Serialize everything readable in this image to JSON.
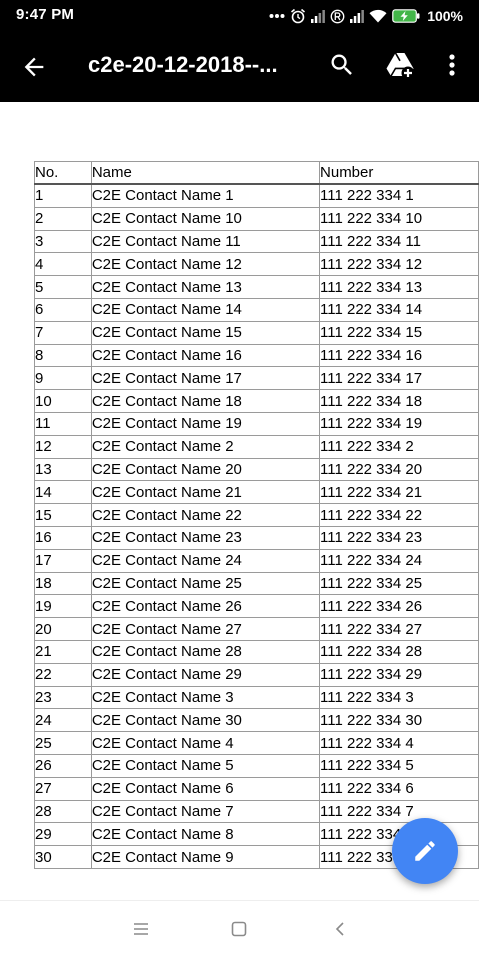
{
  "status_bar": {
    "time": "9:47 PM",
    "battery_percent": "100%",
    "icons": [
      "more-dots-icon",
      "alarm-icon",
      "signal-icon",
      "registered-icon",
      "signal-icon",
      "wifi-icon",
      "battery-charging-icon"
    ]
  },
  "app_bar": {
    "title": "c2e-20-12-2018--...",
    "icons": [
      "back-arrow-icon",
      "search-icon",
      "drive-add-icon",
      "more-vert-icon"
    ]
  },
  "table": {
    "headers": {
      "no": "No.",
      "name": "Name",
      "number": "Number"
    },
    "rows": [
      {
        "no": "1",
        "name": "C2E Contact Name 1",
        "number": "111 222 334 1"
      },
      {
        "no": "2",
        "name": "C2E Contact Name 10",
        "number": "111 222 334 10"
      },
      {
        "no": "3",
        "name": "C2E Contact Name 11",
        "number": "111 222 334 11"
      },
      {
        "no": "4",
        "name": "C2E Contact Name 12",
        "number": "111 222 334 12"
      },
      {
        "no": "5",
        "name": "C2E Contact Name 13",
        "number": "111 222 334 13"
      },
      {
        "no": "6",
        "name": "C2E Contact Name 14",
        "number": "111 222 334 14"
      },
      {
        "no": "7",
        "name": "C2E Contact Name 15",
        "number": "111 222 334 15"
      },
      {
        "no": "8",
        "name": "C2E Contact Name 16",
        "number": "111 222 334 16"
      },
      {
        "no": "9",
        "name": "C2E Contact Name 17",
        "number": "111 222 334 17"
      },
      {
        "no": "10",
        "name": "C2E Contact Name 18",
        "number": "111 222 334 18"
      },
      {
        "no": "11",
        "name": "C2E Contact Name 19",
        "number": "111 222 334 19"
      },
      {
        "no": "12",
        "name": "C2E Contact Name 2",
        "number": "111 222 334 2"
      },
      {
        "no": "13",
        "name": "C2E Contact Name 20",
        "number": "111 222 334 20"
      },
      {
        "no": "14",
        "name": "C2E Contact Name 21",
        "number": "111 222 334 21"
      },
      {
        "no": "15",
        "name": "C2E Contact Name 22",
        "number": "111 222 334 22"
      },
      {
        "no": "16",
        "name": "C2E Contact Name 23",
        "number": "111 222 334 23"
      },
      {
        "no": "17",
        "name": "C2E Contact Name 24",
        "number": "111 222 334 24"
      },
      {
        "no": "18",
        "name": "C2E Contact Name 25",
        "number": "111 222 334 25"
      },
      {
        "no": "19",
        "name": "C2E Contact Name 26",
        "number": "111 222 334 26"
      },
      {
        "no": "20",
        "name": "C2E Contact Name 27",
        "number": "111 222 334 27"
      },
      {
        "no": "21",
        "name": "C2E Contact Name 28",
        "number": "111 222 334 28"
      },
      {
        "no": "22",
        "name": "C2E Contact Name 29",
        "number": "111 222 334 29"
      },
      {
        "no": "23",
        "name": "C2E Contact Name 3",
        "number": "111 222 334 3"
      },
      {
        "no": "24",
        "name": "C2E Contact Name 30",
        "number": "111 222 334 30"
      },
      {
        "no": "25",
        "name": "C2E Contact Name 4",
        "number": "111 222 334 4"
      },
      {
        "no": "26",
        "name": "C2E Contact Name 5",
        "number": "111 222 334 5"
      },
      {
        "no": "27",
        "name": "C2E Contact Name 6",
        "number": "111 222 334 6"
      },
      {
        "no": "28",
        "name": "C2E Contact Name 7",
        "number": "111 222 334 7"
      },
      {
        "no": "29",
        "name": "C2E Contact Name 8",
        "number": "111 222 334 8"
      },
      {
        "no": "30",
        "name": "C2E Contact Name 9",
        "number": "111 222 334 9"
      }
    ]
  },
  "fab": {
    "icon": "edit-pencil-icon",
    "color": "#4285f4"
  },
  "nav_bar": {
    "icons": [
      "menu-icon",
      "home-icon",
      "back-icon"
    ]
  },
  "colors": {
    "app_bar": "#000000",
    "background": "#ffffff",
    "accent": "#4285f4"
  }
}
